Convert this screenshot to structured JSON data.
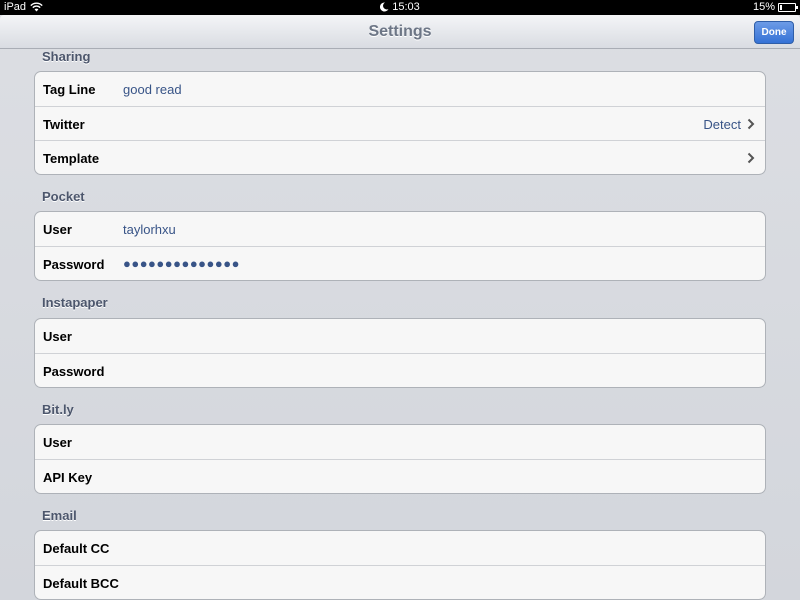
{
  "status_bar": {
    "device": "iPad",
    "time": "15:03",
    "battery": "15%",
    "battery_level": 0.15
  },
  "navbar": {
    "title": "Settings",
    "done_label": "Done"
  },
  "sections": {
    "sharing": {
      "header": "Sharing",
      "tag_line_label": "Tag Line",
      "tag_line_value": "good read",
      "twitter_label": "Twitter",
      "twitter_detail": "Detect",
      "template_label": "Template"
    },
    "pocket": {
      "header": "Pocket",
      "user_label": "User",
      "user_value": "taylorhxu",
      "password_label": "Password",
      "password_value": "●●●●●●●●●●●●●●"
    },
    "instapaper": {
      "header": "Instapaper",
      "user_label": "User",
      "password_label": "Password"
    },
    "bitly": {
      "header": "Bit.ly",
      "user_label": "User",
      "api_key_label": "API Key"
    },
    "email": {
      "header": "Email",
      "default_cc_label": "Default CC",
      "default_bcc_label": "Default BCC"
    }
  },
  "icons": {
    "wifi": "wifi-icon",
    "moon": "moon-icon",
    "battery": "battery-icon",
    "chevron": "chevron-right-icon"
  },
  "colors": {
    "accent": "#3572d6",
    "value_text": "#385487",
    "header_text": "#4c566c"
  }
}
